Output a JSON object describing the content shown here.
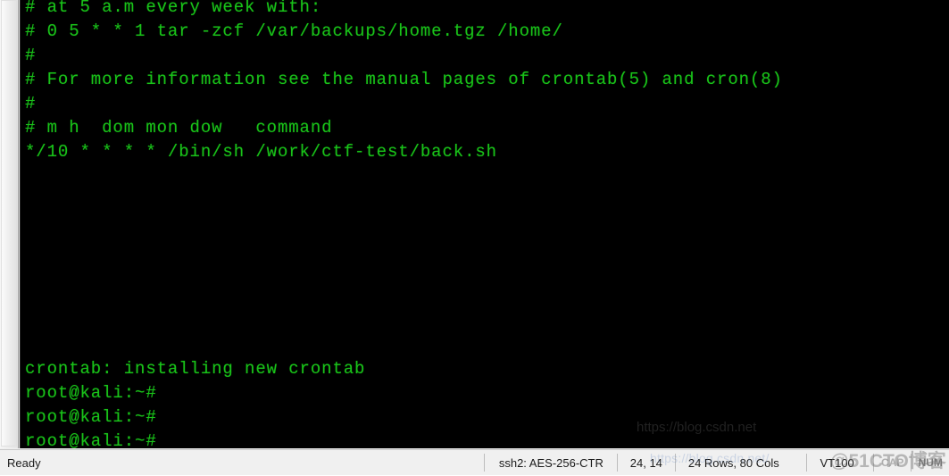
{
  "terminal": {
    "lines": [
      "# at 5 a.m every week with:",
      "# 0 5 * * 1 tar -zcf /var/backups/home.tgz /home/",
      "#",
      "# For more information see the manual pages of crontab(5) and cron(8)",
      "#",
      "# m h  dom mon dow   command",
      "*/10 * * * * /bin/sh /work/ctf-test/back.sh",
      "",
      "",
      "",
      "",
      "",
      "",
      "",
      "",
      "crontab: installing new crontab",
      "root@kali:~#",
      "root@kali:~#",
      "root@kali:~#"
    ],
    "foreground_color": "#19c219",
    "background_color": "#000000"
  },
  "statusbar": {
    "ready_label": "Ready",
    "cipher": "ssh2: AES-256-CTR",
    "cursor_position": "24, 14",
    "dimensions": "24 Rows, 80 Cols",
    "emulation": "VT100",
    "caps_lock": "CAP",
    "num_lock": "NUM"
  },
  "watermarks": {
    "url": "https://blog.csdn.net/",
    "brand": "@51CTO博客",
    "terminal_overlay": "https://blog.csdn.net"
  }
}
